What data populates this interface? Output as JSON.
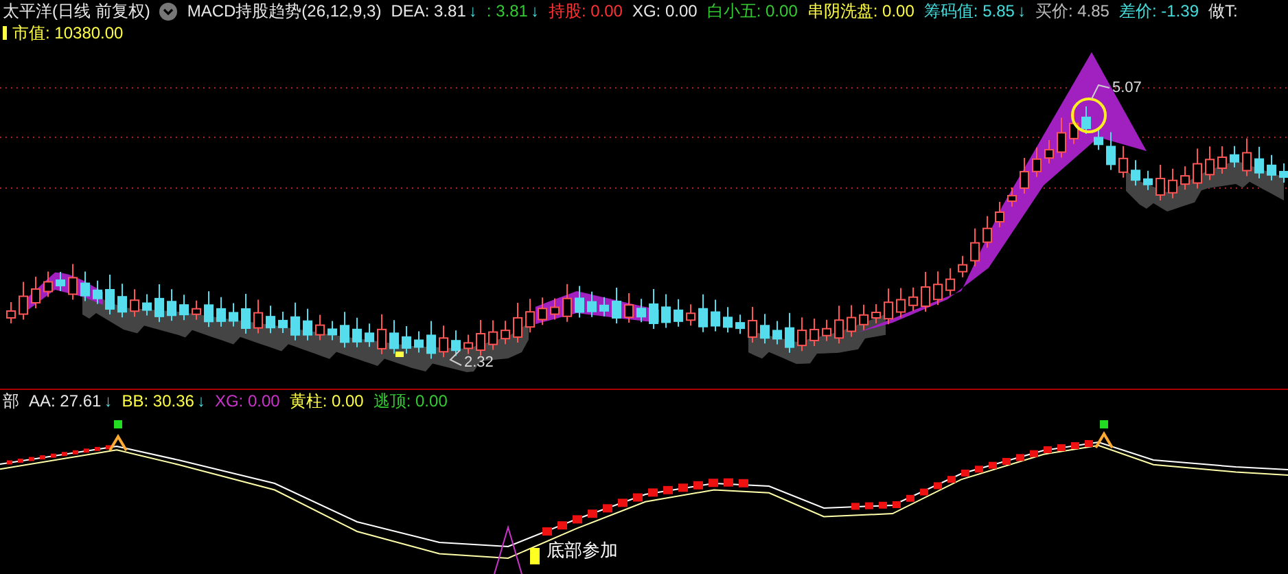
{
  "top_bar": {
    "title": "太平洋(日线 前复权)",
    "indicator": "MACD持股趋势(26,12,9,3)",
    "items": [
      {
        "text": "DEA: 3.81",
        "color": "#e8e8e8",
        "arrow": "↓"
      },
      {
        "text": ": 3.81",
        "color": "#33cc33",
        "arrow": "↓"
      },
      {
        "text": "持股: 0.00",
        "color": "#ff3333"
      },
      {
        "text": "XG: 0.00",
        "color": "#e8e8e8"
      },
      {
        "text": "白小五: 0.00",
        "color": "#33cc33"
      },
      {
        "text": "串阴洗盘: 0.00",
        "color": "#ffff44"
      },
      {
        "text": "筹码值: 5.85",
        "color": "#44dddd",
        "arrow": "↓"
      },
      {
        "text": "买价: 4.85",
        "color": "#bbbbbb"
      },
      {
        "text": "差价: -1.39",
        "color": "#44dddd"
      },
      {
        "text": "做T:",
        "color": "#e8e8e8"
      }
    ]
  },
  "value_bar": {
    "text": "市值: 10380.00"
  },
  "price_chart": {
    "high_label": "5.07",
    "low_label": "2.32"
  },
  "indicator_bar": {
    "title": "部",
    "items": [
      {
        "text": "AA: 27.61",
        "color": "#e8e8e8",
        "arrow": "↓"
      },
      {
        "text": "BB: 30.36",
        "color": "#ffff44",
        "arrow": "↓"
      },
      {
        "text": "XG: 0.00",
        "color": "#cc33cc"
      },
      {
        "text": "黄柱: 0.00",
        "color": "#ffff44"
      },
      {
        "text": "逃顶: 0.00",
        "color": "#33cc33"
      }
    ]
  },
  "indicator_chart": {
    "signal_label": "底部参加"
  }
}
